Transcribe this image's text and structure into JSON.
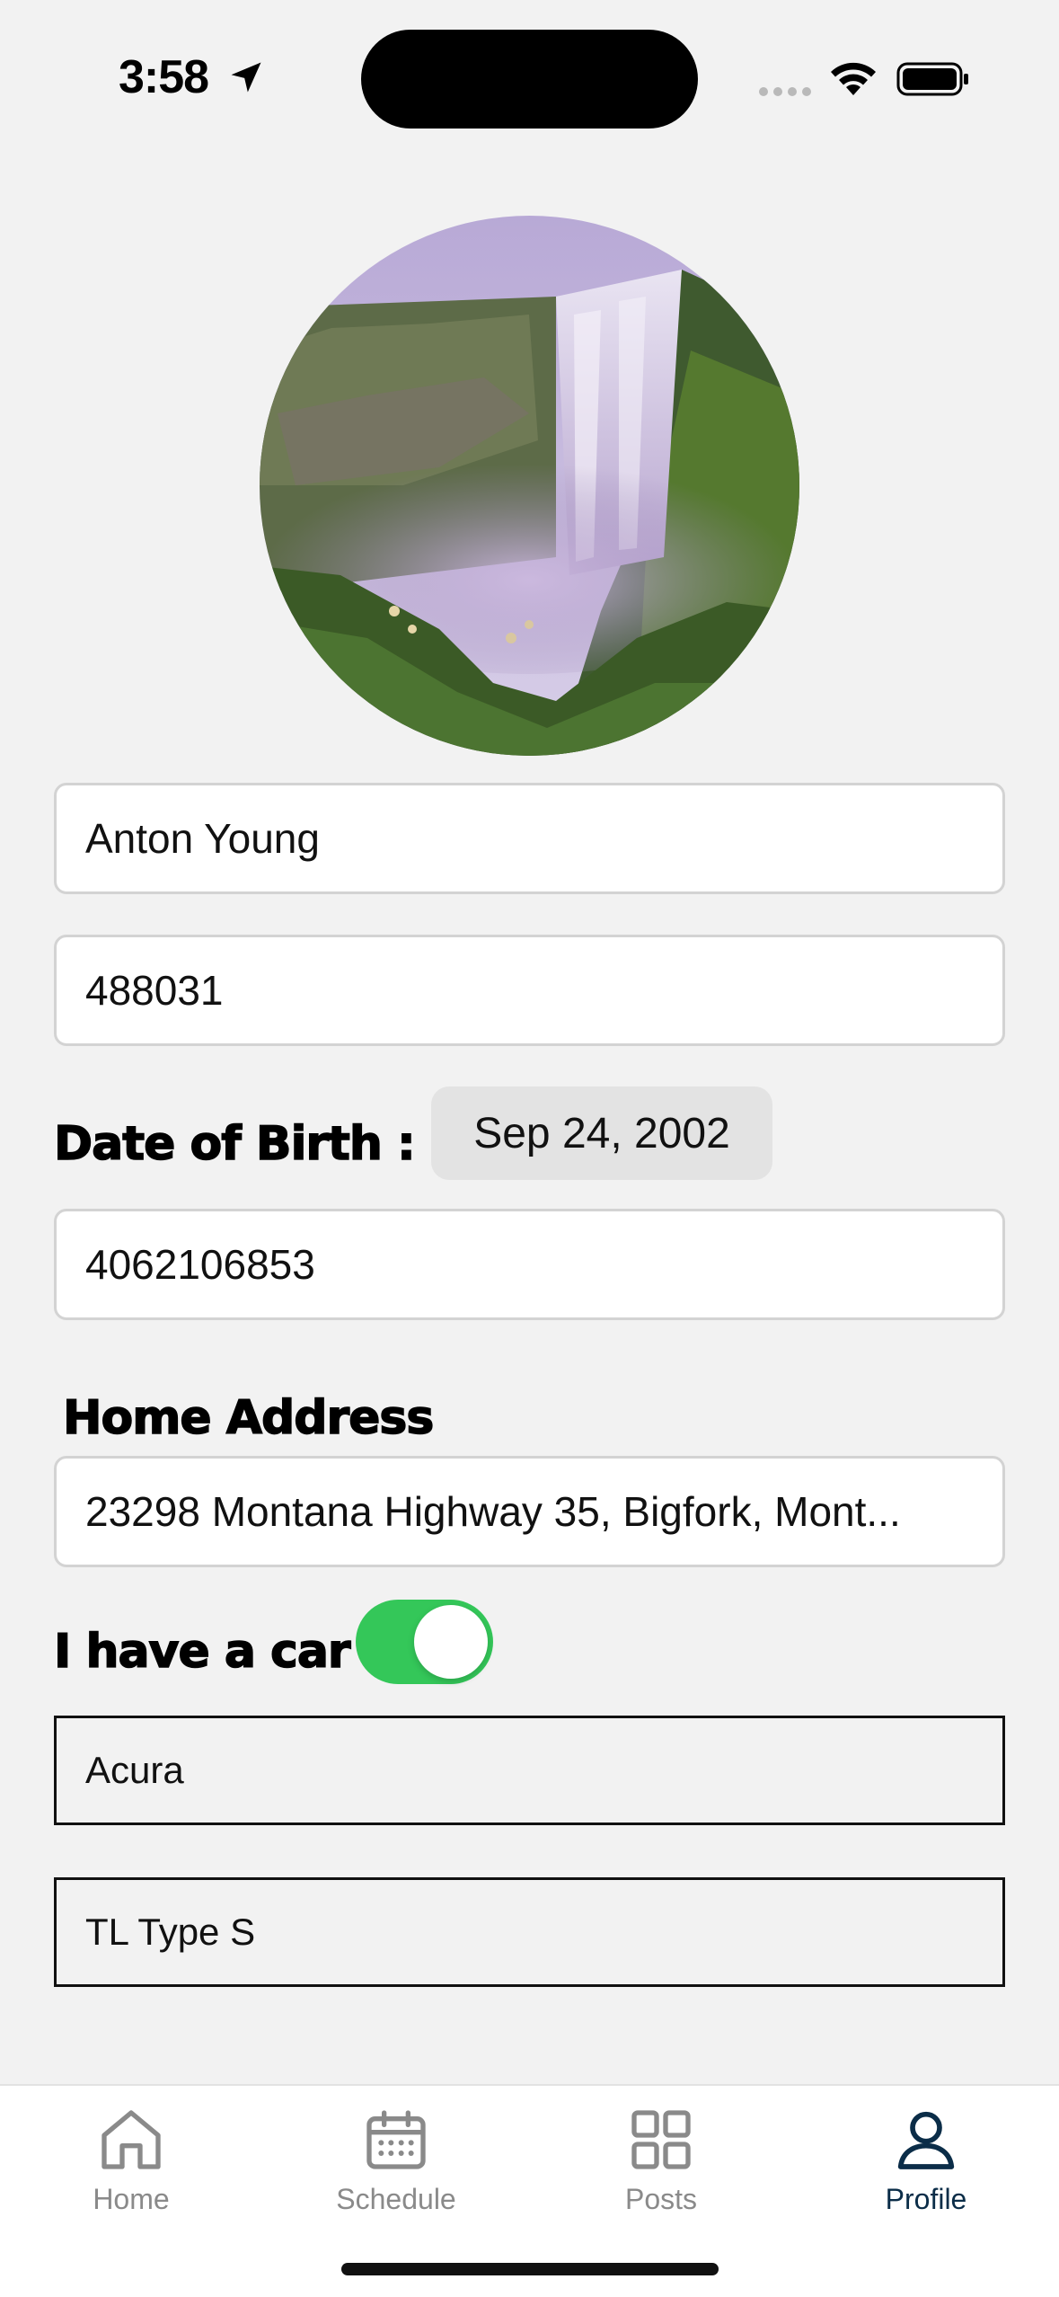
{
  "status_bar": {
    "time": "3:58",
    "icons": [
      "location-arrow-icon",
      "wifi-icon",
      "battery-icon"
    ]
  },
  "profile": {
    "avatar": "waterfall-photo",
    "name_value": "Anton Young",
    "id_value": "488031",
    "dob_label": "Date of Birth :",
    "dob_value": "Sep 24, 2002",
    "phone_value": "4062106853",
    "address_label": "Home Address",
    "address_value": "23298 Montana Highway 35, Bigfork, Mont...",
    "car_label": "I have a car",
    "car_toggle_on": true,
    "car_make_value": "Acura",
    "car_model_value": "TL Type S"
  },
  "tabbar": {
    "tabs": [
      {
        "label": "Home",
        "icon": "house-icon",
        "active": false
      },
      {
        "label": "Schedule",
        "icon": "calendar-icon",
        "active": false
      },
      {
        "label": "Posts",
        "icon": "grid-icon",
        "active": false
      },
      {
        "label": "Profile",
        "icon": "person-icon",
        "active": true
      }
    ]
  },
  "colors": {
    "background": "#f2f2f2",
    "toggle_on": "#34c759",
    "tab_active": "#0b2d48",
    "tab_inactive": "#8a8a8a"
  }
}
